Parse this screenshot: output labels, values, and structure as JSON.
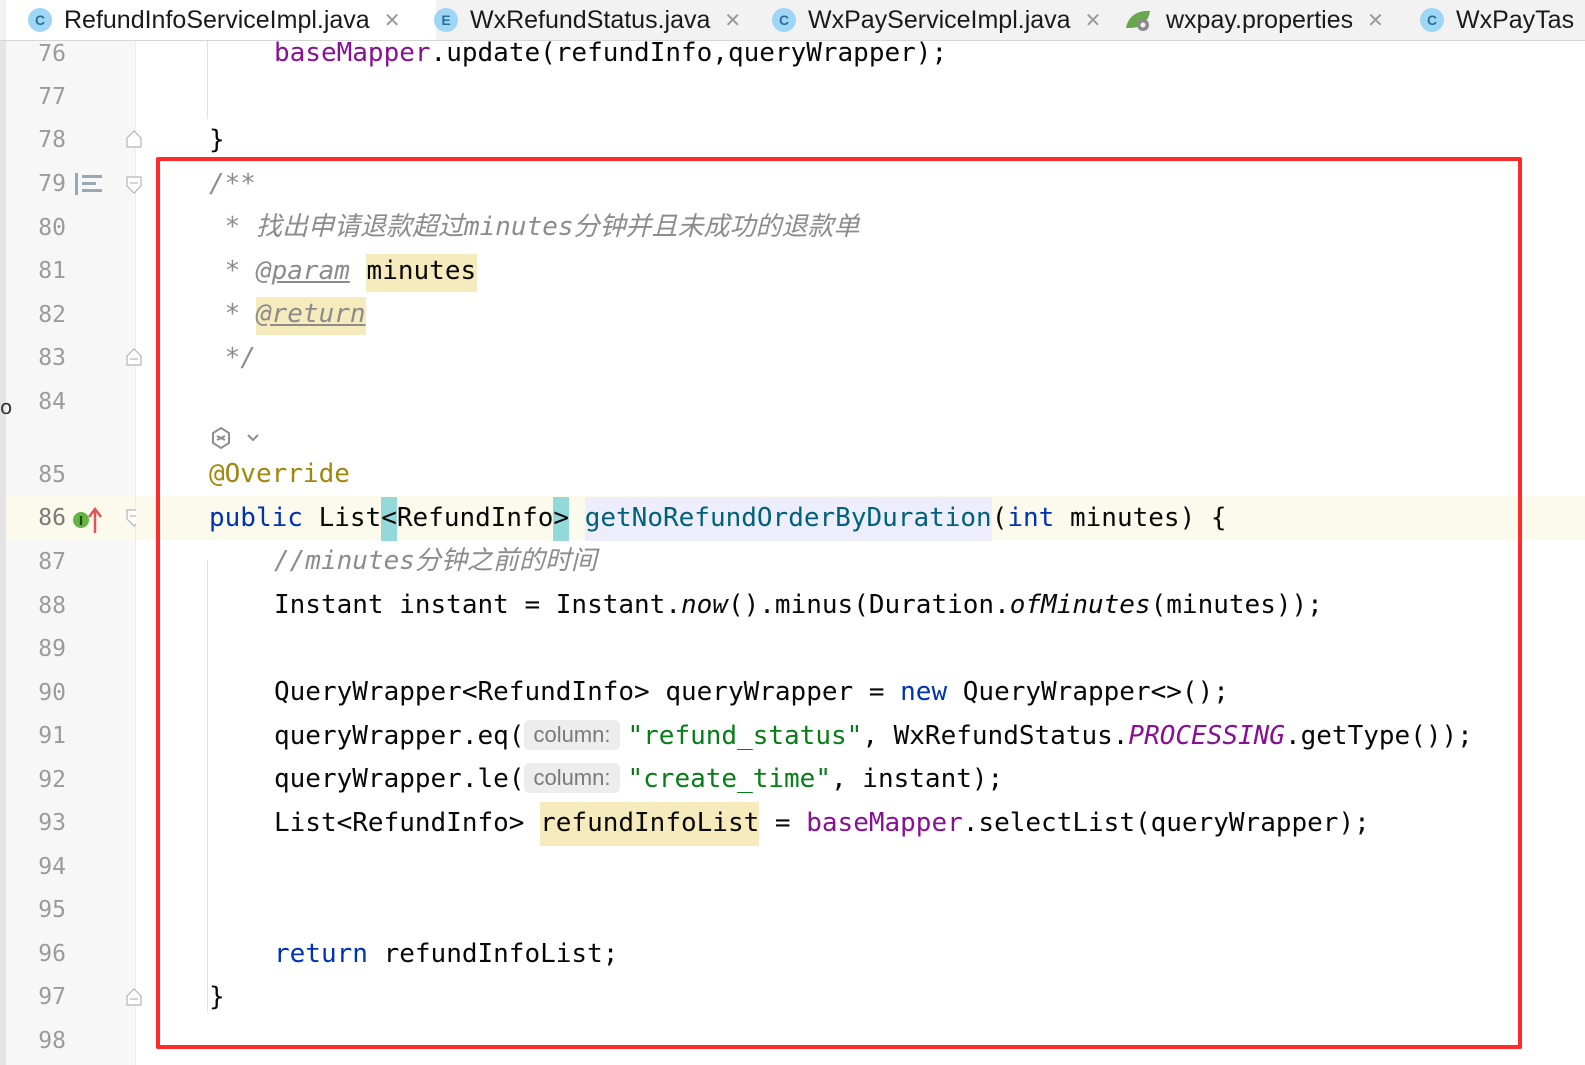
{
  "tabs": [
    {
      "icon": "C",
      "label": "RefundInfoServiceImpl.java",
      "active": true
    },
    {
      "icon": "E",
      "label": "WxRefundStatus.java",
      "active": false
    },
    {
      "icon": "C",
      "label": "WxPayServiceImpl.java",
      "active": false
    },
    {
      "icon": "properties-file-icon",
      "label": "wxpay.properties",
      "active": false
    },
    {
      "icon": "C",
      "label": "WxPayTas",
      "active": false
    }
  ],
  "line_numbers": [
    "76",
    "77",
    "78",
    "79",
    "80",
    "81",
    "82",
    "83",
    "84",
    "85",
    "86",
    "87",
    "88",
    "89",
    "90",
    "91",
    "92",
    "93",
    "94",
    "95",
    "96",
    "97",
    "98"
  ],
  "current_line": "86",
  "code": {
    "l76": {
      "a": "baseMapper",
      "b": ".update(refundInfo,queryWrapper);"
    },
    "l78": "}",
    "l79": "/**",
    "l80": " * 找出申请退款超过minutes分钟并且未成功的退款单",
    "l81": {
      "star": " * ",
      "tag": "@param",
      "param": "minutes"
    },
    "l82": {
      "star": " * ",
      "tag": "@return"
    },
    "l83": " */",
    "l85": "@Override",
    "l86": {
      "public": "public",
      "list": " List",
      "lt": "<",
      "type": "RefundInfo",
      "gt": ">",
      "method": "getNoRefundOrderByDuration",
      "open": "(",
      "int": "int",
      "rest": " minutes) {"
    },
    "l87": "//minutes分钟之前的时间",
    "l88": {
      "a": "Instant instant = Instant.",
      "now": "now",
      "b": "().minus(Duration.",
      "of": "ofMinutes",
      "c": "(minutes));"
    },
    "l90": {
      "a": "QueryWrapper<RefundInfo> queryWrapper = ",
      "new": "new",
      "b": " QueryWrapper<>();"
    },
    "l91": {
      "a": "queryWrapper.eq(",
      "hint": "column:",
      "str": "\"refund_status\"",
      "b": ", WxRefundStatus.",
      "enum": "PROCESSING",
      "c": ".getType());"
    },
    "l92": {
      "a": "queryWrapper.le(",
      "hint": "column:",
      "str": "\"create_time\"",
      "b": ", instant);"
    },
    "l93": {
      "a": "List<RefundInfo> ",
      "var": "refundInfoList",
      "b": " = ",
      "field": "baseMapper",
      "c": ".selectList(queryWrapper);"
    },
    "l96": {
      "ret": "return",
      "b": " refundInfoList;"
    },
    "l97": "}"
  },
  "gutter_markers": {
    "implements_icon": "I",
    "override_arrow": "↑"
  },
  "left_edge_mark": "o"
}
